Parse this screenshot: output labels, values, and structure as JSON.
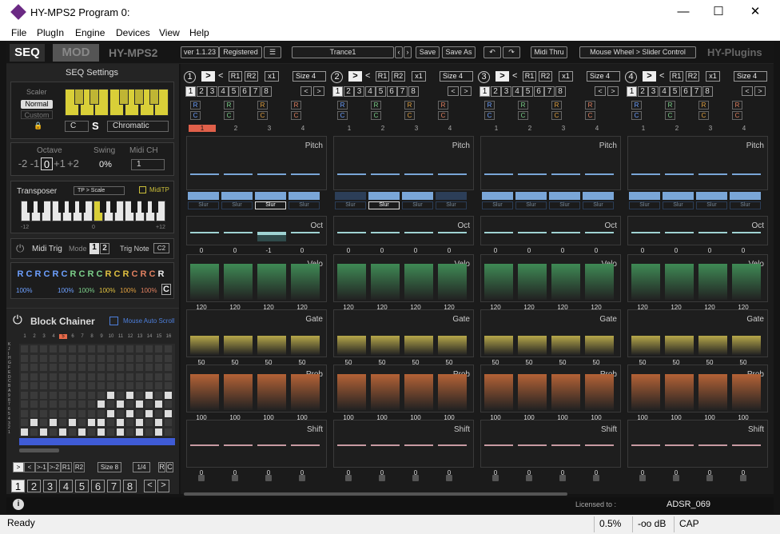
{
  "window": {
    "title": "HY-MPS2 Program 0:",
    "min": "—",
    "max": "☐",
    "close": "✕"
  },
  "menu": [
    "File",
    "PlugIn",
    "Engine",
    "Devices",
    "View",
    "Help"
  ],
  "topbar": {
    "tab_seq": "SEQ",
    "tab_mod": "MOD",
    "product": "HY-MPS2",
    "version": "ver 1.1.23",
    "registered": "Registered",
    "hamburger": "☰",
    "preset": "Trance1",
    "save": "Save",
    "save_as": "Save As",
    "midi_thru": "Midi Thru",
    "wheel": "Mouse Wheel > Slider Control",
    "brand": "HY-Plugins"
  },
  "seq_settings": {
    "title": "SEQ Settings",
    "scaler": "Scaler",
    "normal": "Normal",
    "custom": "Custom",
    "key": "C",
    "s": "S",
    "scale": "Chromatic",
    "octave_label": "Octave",
    "swing_label": "Swing",
    "midich_label": "Midi CH",
    "octaves": [
      "-2",
      "-1",
      "0",
      "+1",
      "+2"
    ],
    "swing": "0%",
    "midich": "1",
    "transposer": "Transposer",
    "tp_mode": "TP > Scale",
    "miditp": "MidiTP",
    "tp_min": "-12",
    "tp_mid": "0",
    "tp_max": "+12",
    "midi_trig": "Midi Trig",
    "mode": "Mode",
    "mode_a": "1",
    "mode_b": "2",
    "trig_note": "Trig Note",
    "trig_val": "C2",
    "rc_letters": [
      "R",
      "C",
      "R",
      "C",
      "R",
      "C",
      "R",
      "C",
      "R",
      "C",
      "R",
      "C",
      "R",
      "C",
      "R",
      "C",
      "R"
    ],
    "rc_last": "C",
    "rc_percents": [
      "100%",
      "100%",
      "100%",
      "100%",
      "100%",
      "100%"
    ]
  },
  "chainer": {
    "title": "Block Chainer",
    "auto_scroll": "Mouse Auto Scroll",
    "cols": [
      "1",
      "2",
      "3",
      "4",
      "5",
      "6",
      "7",
      "8",
      "9",
      "10",
      "11",
      "12",
      "13",
      "14",
      "15",
      "16"
    ],
    "rows": [
      "K",
      "J",
      "I",
      "H",
      "G",
      "F",
      "E",
      "D",
      "C",
      "B",
      "A",
      "9",
      "8",
      "7",
      "6",
      "5",
      "4",
      "3",
      "2",
      "1"
    ],
    "controls": [
      ">",
      "<",
      ">-1",
      ">-2",
      "R1",
      "R2"
    ],
    "size": "Size 8",
    "ratio": "1/4",
    "rc": "R",
    "c": "C",
    "blocks": [
      "1",
      "2",
      "3",
      "4",
      "5",
      "6",
      "7",
      "8"
    ],
    "prev": "<",
    "next": ">"
  },
  "blocks": [
    {
      "num": "1",
      "oct": [
        "0",
        "0",
        "-1",
        "0"
      ]
    },
    {
      "num": "2",
      "oct": [
        "0",
        "0",
        "0",
        "0"
      ]
    },
    {
      "num": "3",
      "oct": [
        "0",
        "0",
        "0",
        "0"
      ]
    },
    {
      "num": "4",
      "oct": [
        "0",
        "0",
        "0",
        "0"
      ]
    }
  ],
  "block_header": {
    "play": ">",
    "back": "<",
    "r1": "R1",
    "r2": "R2",
    "x1": "x1",
    "size": "Size 4",
    "steps": [
      "1",
      "2",
      "3",
      "4",
      "5",
      "6",
      "7",
      "8"
    ],
    "left": "<",
    "right": ">",
    "step_labels": [
      "1",
      "2",
      "3",
      "4"
    ],
    "r": "R",
    "c": "C"
  },
  "lanes": {
    "pitch": {
      "label": "Pitch",
      "values": [
        "C",
        "C",
        "C",
        "C"
      ]
    },
    "slur": {
      "label": "Slur"
    },
    "oct": {
      "label": "Oct"
    },
    "velo": {
      "label": "Velo",
      "values": [
        "120",
        "120",
        "120",
        "120"
      ]
    },
    "gate": {
      "label": "Gate",
      "values": [
        "50",
        "50",
        "50",
        "50"
      ]
    },
    "prob": {
      "label": "Prob",
      "values": [
        "100",
        "100",
        "100",
        "100"
      ]
    },
    "shift": {
      "label": "Shift",
      "values": [
        "0",
        "0",
        "0",
        "0"
      ]
    }
  },
  "colors": {
    "velo": "#3f8a55",
    "gate": "#b7a84a",
    "prob": "#b46236",
    "pitch": "#7aa6d8",
    "shift": "#c79aa2",
    "oct": "#9fd3d3"
  },
  "info": {
    "licensed": "Licensed to :",
    "user": "ADSR_069"
  },
  "status": {
    "ready": "Ready",
    "pct": "0.5%",
    "db": "-oo dB",
    "cap": "CAP"
  }
}
